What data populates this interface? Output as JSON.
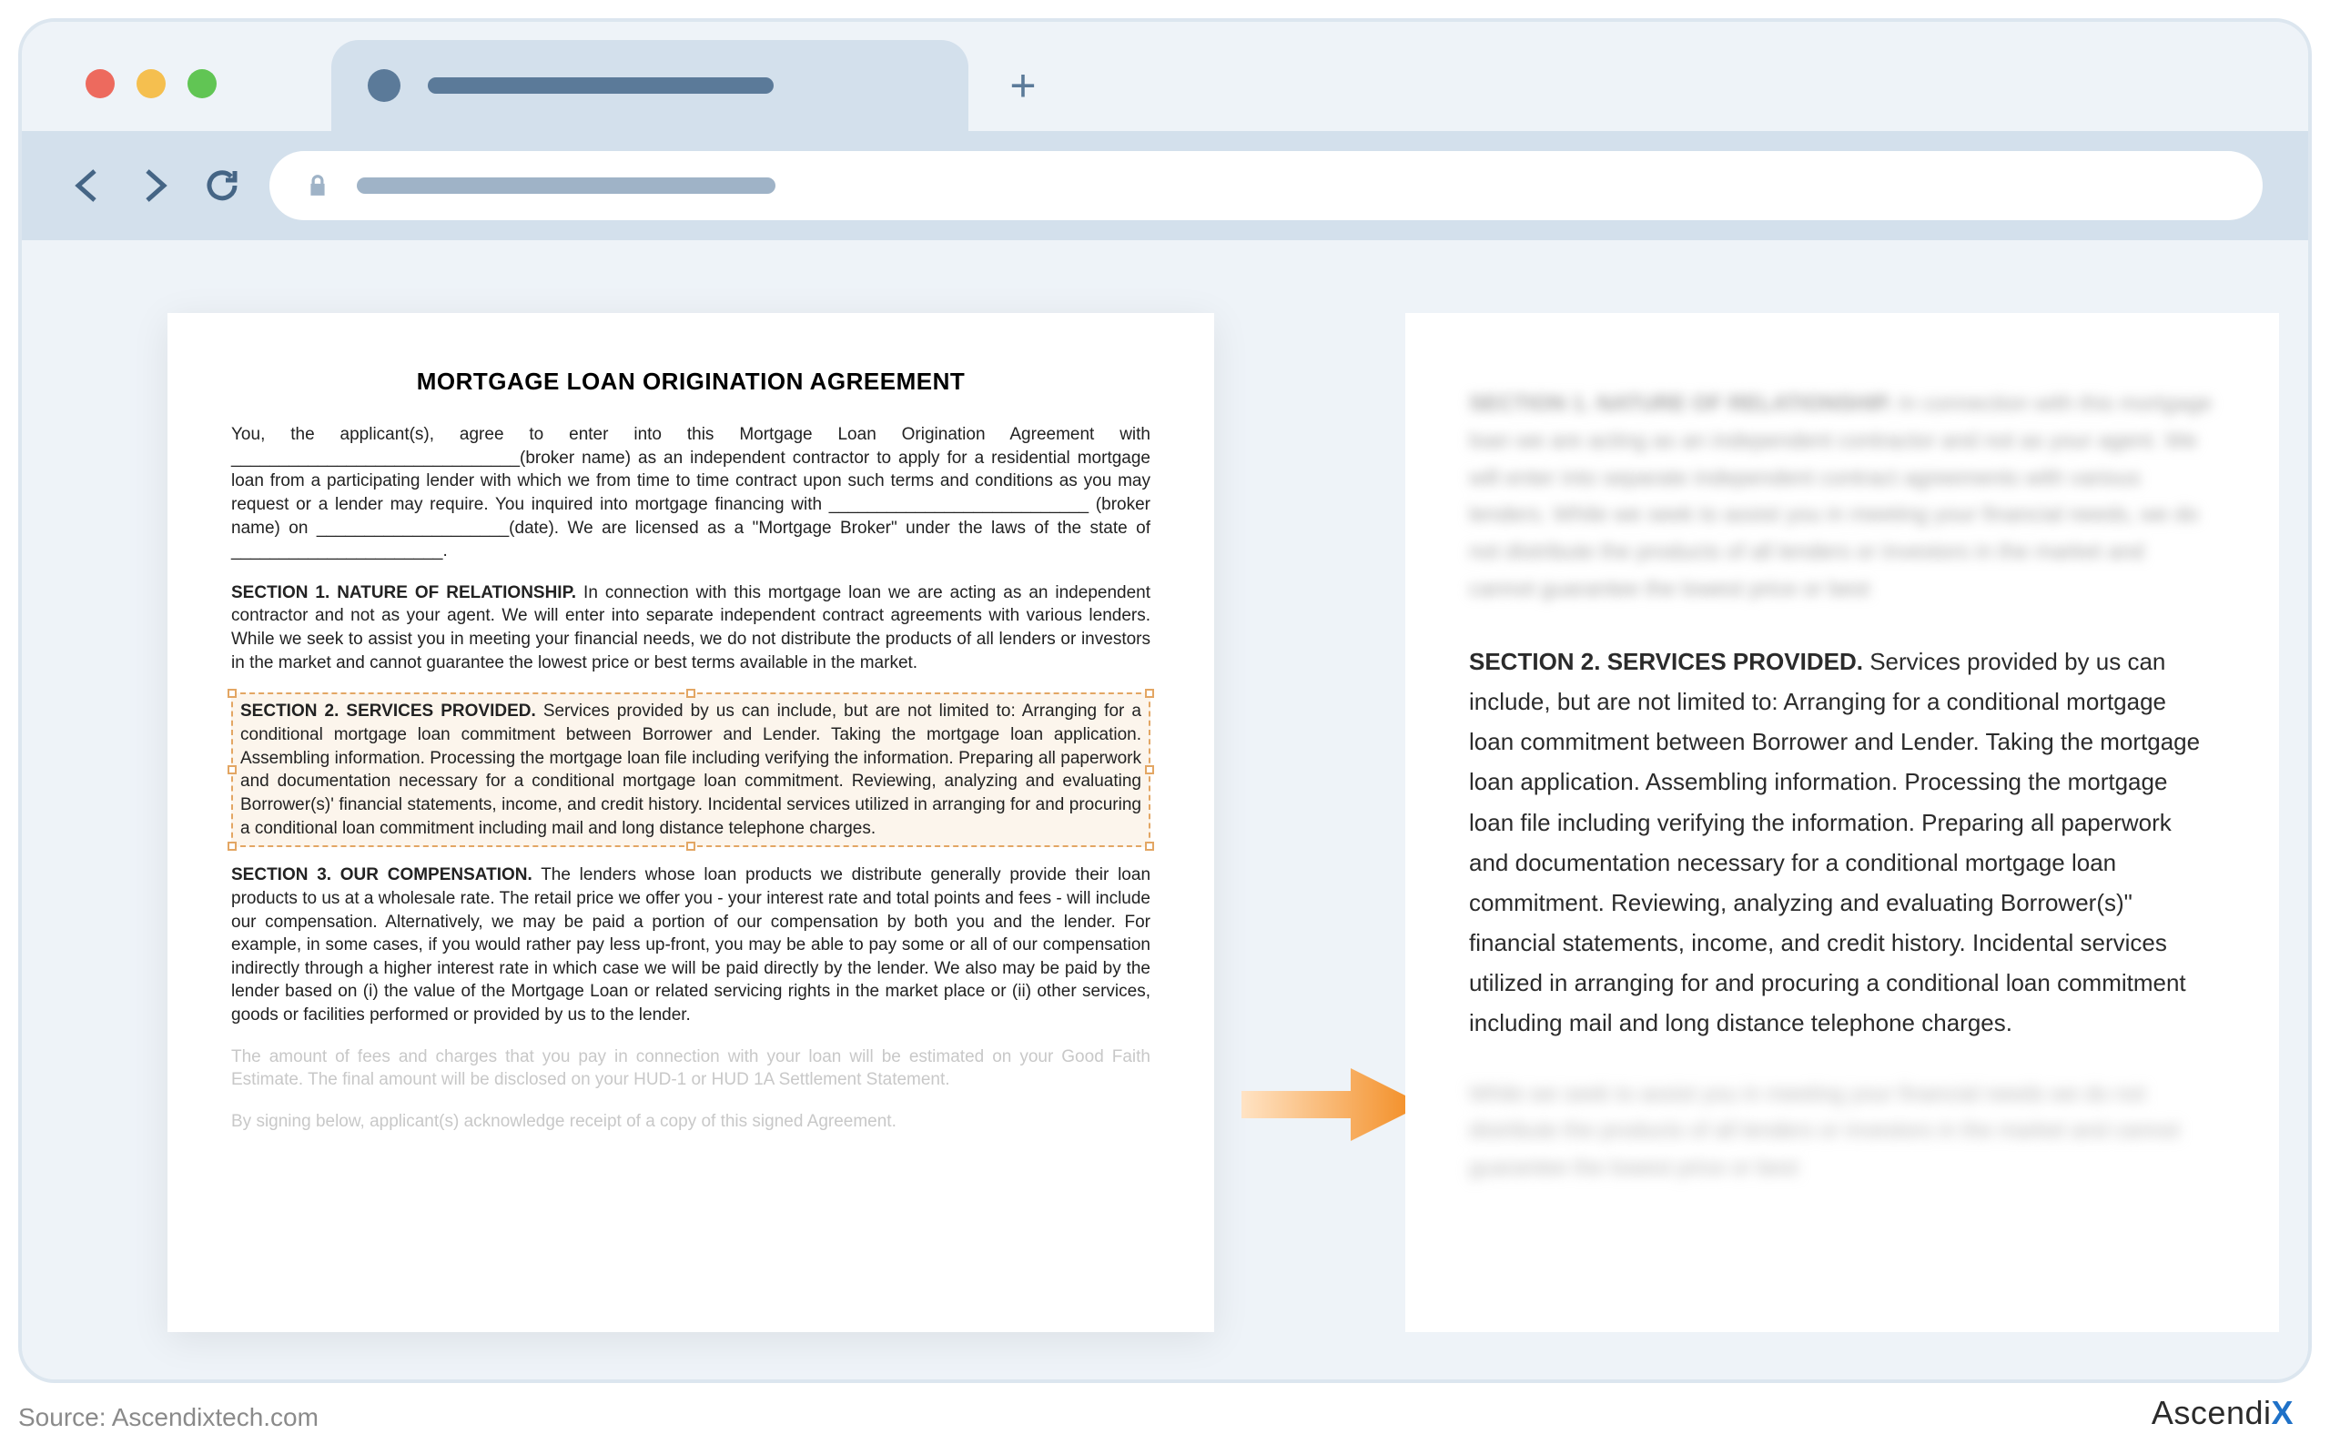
{
  "browser": {
    "new_tab_glyph": "+"
  },
  "document": {
    "title": "MORTGAGE LOAN ORIGINATION AGREEMENT",
    "intro": "You, the applicant(s), agree to enter into this Mortgage Loan Origination Agreement with ______________________________(broker name) as an independent contractor to apply for a residential mortgage loan from a participating lender with which we from time to time contract upon such terms and conditions as you may request or a lender may require.  You inquired into mortgage financing with ___________________________ (broker name) on ____________________(date).  We are licensed as a \"Mortgage Broker\" under the laws of the state of ______________________.",
    "section1_head": "SECTION 1. NATURE OF RELATIONSHIP.",
    "section1_body": "In connection with this mortgage loan we are acting as an independent contractor and not as your agent.  We will enter into separate independent contract agreements with various lenders.  While we seek to assist you in meeting your financial needs, we do not distribute the products of all lenders or investors in the market and cannot guarantee the lowest price or best terms available in the market.",
    "section2_head": "SECTION 2.  SERVICES PROVIDED.",
    "section2_body": "Services provided by us can include, but are not limited to: Arranging for a conditional mortgage loan commitment between Borrower and Lender.  Taking the mortgage loan application.  Assembling information.  Processing the mortgage loan file including verifying the information.  Preparing all paperwork and documentation necessary for a conditional mortgage loan commitment. Reviewing, analyzing and evaluating Borrower(s)' financial statements, income, and credit history.  Incidental services utilized in arranging for and procuring a conditional loan commitment including mail and long distance telephone charges.",
    "section3_head": "SECTION 3. OUR COMPENSATION.",
    "section3_body": "The lenders whose loan products we distribute generally provide their loan products to us at a wholesale rate.  The retail price we offer you - your interest rate and total points and fees - will include our compensation. Alternatively, we may be paid a portion of our compensation by both you and the lender.  For example, in some cases, if you would rather pay less up-front, you may be able to pay some or all of our compensation indirectly through a higher interest rate in which case we will be paid directly by the lender.  We also may be paid by the lender based on (i) the value of the Mortgage Loan or related servicing rights in the market place or (ii) other services, goods or facilities performed or provided by us to the lender.",
    "fees_para": "The amount of fees and charges that you pay in connection with your loan will be estimated on your Good Faith Estimate.  The final amount will be disclosed on your HUD-1 or HUD 1A Settlement Statement.",
    "signing_para": "By signing below, applicant(s) acknowledge receipt of a copy of this signed Agreement."
  },
  "extracted": {
    "blur_top_head": "SECTION 1. NATURE OF RELATIONSHIP.",
    "blur_top_body": "In connection with this mortgage loan we are acting as an independent contractor and not as your agent. We will enter into separate independent contract agreements with various lenders. While we seek to assist you in meeting your financial needs, we do not distribute the products of all lenders or investors in the market and cannot guarantee the lowest price or best",
    "main_head": "SECTION 2. SERVICES PROVIDED.",
    "main_body": "Services provided by us can include, but are not limited to: Arranging for a conditional mortgage loan commitment between Borrower and Lender. Taking the mortgage loan application. Assembling information. Processing the mortgage loan file including verifying the information. Preparing all paperwork and documentation necessary for a conditional mortgage loan commitment. Reviewing, analyzing and evaluating Borrower(s)\" financial statements, income, and credit history. Incidental services utilized in arranging for and procuring a conditional loan commitment including mail and long distance telephone charges.",
    "blur_bottom": "While we seek to assist you in meeting your financial needs we do not distribute the products of all lenders or investors in the market and cannot guarantee the lowest price or best"
  },
  "footer": {
    "source": "Source: Ascendixtech.com",
    "brand_a": "Ascendi",
    "brand_b": "X"
  }
}
